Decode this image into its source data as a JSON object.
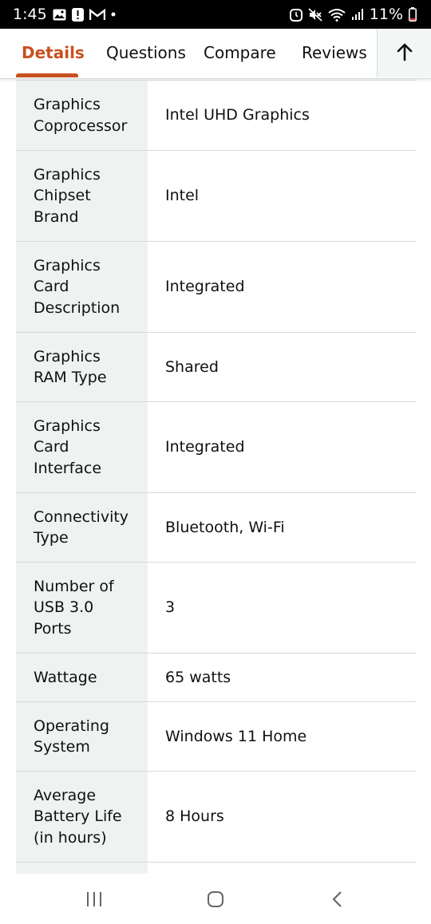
{
  "status_bar": {
    "time": "1:45",
    "battery": "11%",
    "icons": [
      "image-icon",
      "alert-icon",
      "gmail-icon",
      "dot-icon",
      "alarm-icon",
      "mute-icon",
      "wifi-icon",
      "signal-icon",
      "battery-icon"
    ]
  },
  "tabs": [
    {
      "label": "Details",
      "active": true
    },
    {
      "label": "Questions",
      "active": false
    },
    {
      "label": "Compare",
      "active": false
    },
    {
      "label": "Reviews",
      "active": false
    }
  ],
  "accent_color": "#c7511f",
  "specs": [
    {
      "key": "Graphics Coprocessor",
      "value": "Intel UHD Graphics"
    },
    {
      "key": "Graphics Chipset Brand",
      "value": "Intel"
    },
    {
      "key": "Graphics Card Description",
      "value": "Integrated"
    },
    {
      "key": "Graphics RAM Type",
      "value": "Shared"
    },
    {
      "key": "Graphics Card Interface",
      "value": "Integrated"
    },
    {
      "key": "Connectivity Type",
      "value": "Bluetooth, Wi-Fi"
    },
    {
      "key": "Number of USB 3.0 Ports",
      "value": "3"
    },
    {
      "key": "Wattage",
      "value": "65 watts"
    },
    {
      "key": "Operating System",
      "value": "Windows 11 Home"
    },
    {
      "key": "Average Battery Life (in hours)",
      "value": "8 Hours"
    }
  ],
  "nav": {
    "icons": [
      "recent-apps-icon",
      "home-icon",
      "back-icon"
    ]
  }
}
